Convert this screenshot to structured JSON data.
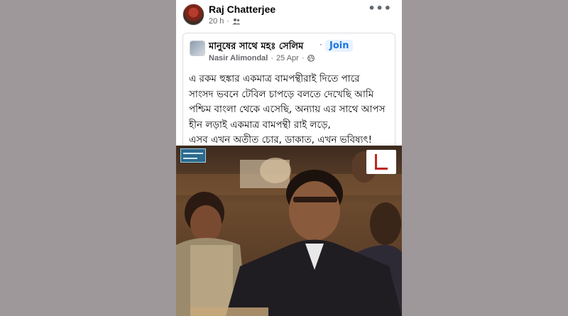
{
  "post": {
    "author": "Raj Chatterjee",
    "time": "20 h",
    "dot": "·",
    "audience_icon": "friends-icon",
    "more_icon": "more-options-icon",
    "more_label": "•••"
  },
  "shared": {
    "group_name": "মানুষের সাথে মহঃ সেলিম",
    "separator": "·",
    "join_label": "Join",
    "author": "Nasir Alimondal",
    "date": "25 Apr",
    "dot": "·",
    "audience_icon": "globe-icon",
    "text_lines": [
      "এ রকম হুঙ্কার একমাত্র বামপন্থীরাই দিতে পারে",
      "সাংসদ ভবনে টেবিল চাপড়ে বলতে দেখেছি আমি",
      "পশ্চিম বাংলা থেকে এসেছি, অন্যায় এর সাথে আপস",
      "হীন লড়াই একমাত্র বামপন্থী রাই লড়ে,",
      "এসব এখন অতীত চোর, ডাকাত, এখন ভবিষ্যৎ!"
    ]
  },
  "colors": {
    "background": "#9e989a",
    "link_blue": "#1b74e4",
    "meta_gray": "#65676b"
  }
}
